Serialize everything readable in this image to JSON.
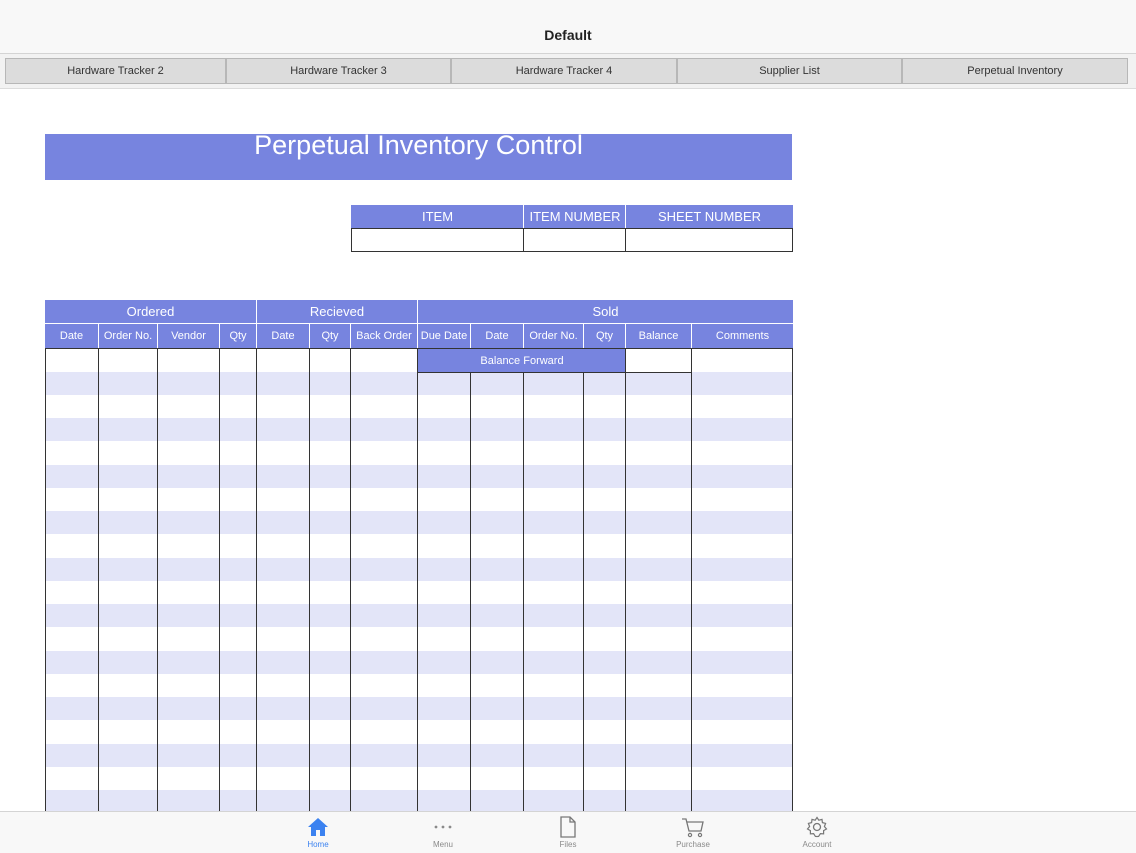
{
  "window": {
    "title": "Default"
  },
  "tabs": [
    {
      "label": "Hardware Tracker 2"
    },
    {
      "label": "Hardware Tracker 3"
    },
    {
      "label": "Hardware Tracker 4"
    },
    {
      "label": "Supplier List"
    },
    {
      "label": "Perpetual Inventory"
    }
  ],
  "sheet": {
    "title": "Perpetual Inventory Control",
    "item_table": {
      "headers": [
        "ITEM",
        "ITEM NUMBER",
        "SHEET NUMBER"
      ],
      "values": [
        "",
        "",
        ""
      ]
    },
    "groups": {
      "ordered": "Ordered",
      "received": "Recieved",
      "sold": "Sold"
    },
    "columns": {
      "ordered_date": "Date",
      "ordered_order_no": "Order No.",
      "ordered_vendor": "Vendor",
      "ordered_qty": "Qty",
      "received_date": "Date",
      "received_qty": "Qty",
      "received_back_order": "Back Order",
      "sold_due_date": "Due Date",
      "sold_date": "Date",
      "sold_order_no": "Order No.",
      "sold_qty": "Qty",
      "balance": "Balance",
      "comments": "Comments"
    },
    "balance_forward_label": "Balance Forward",
    "balance_forward_value": ""
  },
  "bottom_nav": [
    {
      "label": "Home",
      "icon": "home-icon",
      "active": true
    },
    {
      "label": "Menu",
      "icon": "more-icon",
      "active": false
    },
    {
      "label": "Files",
      "icon": "file-icon",
      "active": false
    },
    {
      "label": "Purchase",
      "icon": "cart-icon",
      "active": false
    },
    {
      "label": "Account",
      "icon": "gear-icon",
      "active": false
    }
  ],
  "colors": {
    "header_fill": "#7784df",
    "stripe": "#e3e5f8",
    "active": "#3b82f0"
  }
}
